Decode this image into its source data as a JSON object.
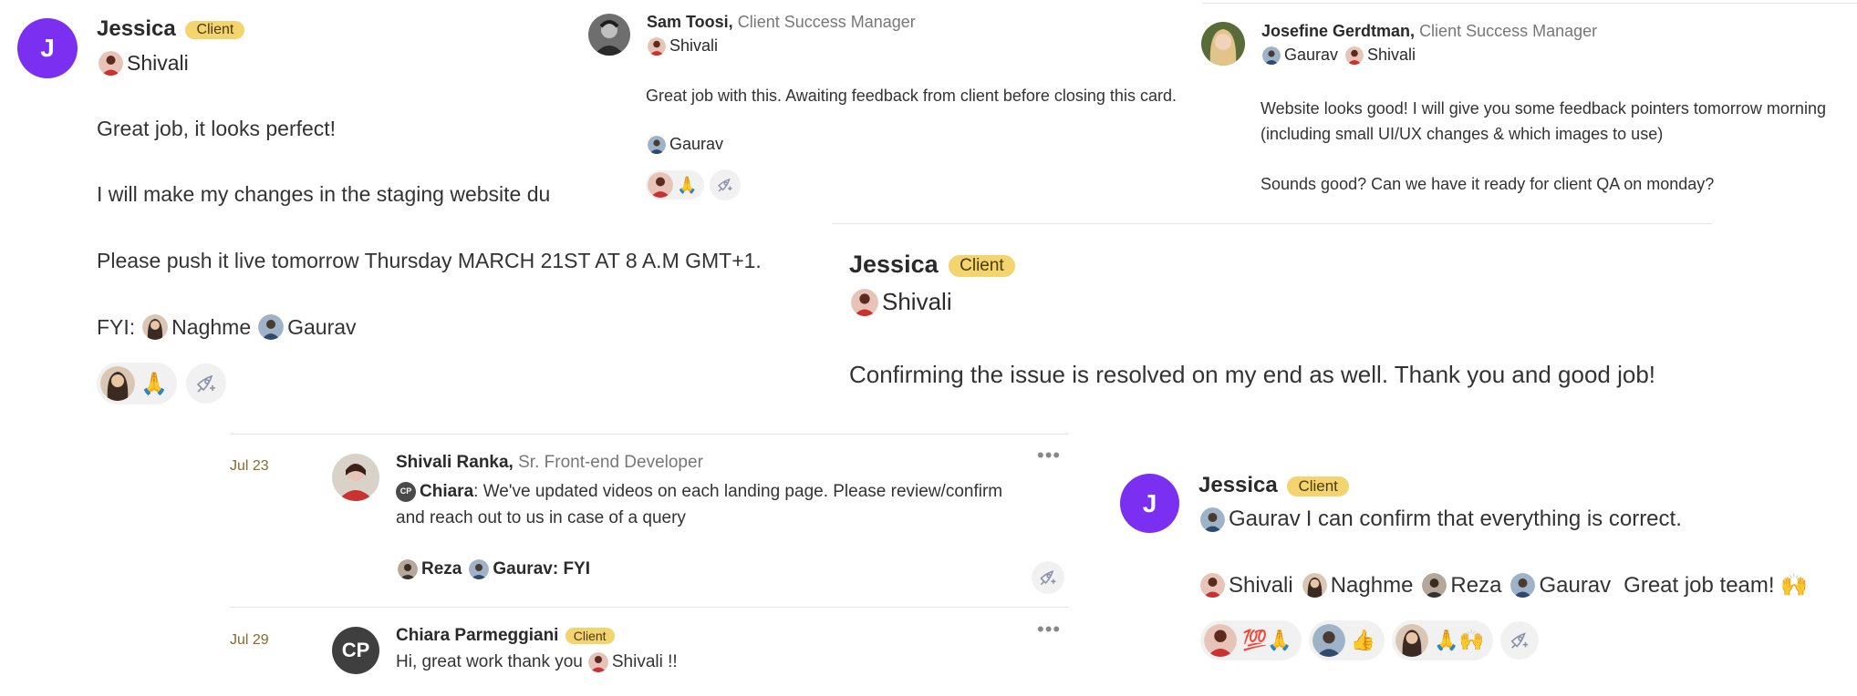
{
  "card1": {
    "avatar_letter": "J",
    "name": "Jessica",
    "badge": "Client",
    "mention": "Shivali",
    "line1": "Great job, it looks perfect!",
    "line2": "I will make my changes in the staging website du",
    "line3": "Please push it live tomorrow Thursday MARCH 21ST AT 8 A.M GMT+1.",
    "fyi_label": "FYI:",
    "fyi_mention1": "Naghme",
    "fyi_mention2": "Gaurav",
    "reaction_emoji": "🙏"
  },
  "card2": {
    "name": "Sam Toosi,",
    "role": "Client Success Manager",
    "mention": "Shivali",
    "text": "Great job with this. Awaiting feedback from client before closing this card.",
    "mention2": "Gaurav",
    "reaction_emoji": "🙏"
  },
  "card3": {
    "name": "Josefine Gerdtman,",
    "role": "Client Success Manager",
    "mention1": "Gaurav",
    "mention2": "Shivali",
    "text1": "Website looks good! I will give you some feedback pointers tomorrow morning",
    "text2": "(including small UI/UX changes & which images to use)",
    "text3": "Sounds good? Can we have it ready for client QA on monday?"
  },
  "card4": {
    "name": "Jessica",
    "badge": "Client",
    "mention": "Shivali",
    "text": "Confirming the issue is resolved on my end as well. Thank you and good job!"
  },
  "card5": {
    "date1": "Jul 23",
    "name1": "Shivali Ranka,",
    "role1": "Sr. Front-end Developer",
    "chiara_initials": "CP",
    "chiara_mention": "Chiara",
    "msg1a": ": We've updated videos on each landing page. Please review/confirm",
    "msg1b": "and reach out to us in case of a query",
    "mention_reza": "Reza",
    "mention_gaurav": "Gaurav: FYI",
    "dots": "•••",
    "date2": "Jul 29",
    "avatar2": "CP",
    "name2": "Chiara Parmeggiani",
    "badge2": "Client",
    "msg2_prefix": "Hi, great work thank you",
    "msg2_mention": "Shivali !!"
  },
  "card6": {
    "avatar_letter": "J",
    "name": "Jessica",
    "badge": "Client",
    "mention": "Gaurav",
    "text1": "I can confirm that everything is correct.",
    "m1": "Shivali",
    "m2": "Naghme",
    "m3": "Reza",
    "m4": "Gaurav",
    "text2": "Great job team! 🙌",
    "r1_emoji": "💯🙏",
    "r2_emoji": "👍",
    "r3_emoji": "🙏🙌"
  },
  "colors": {
    "accent_purple": "#7b2ff0",
    "badge_yellow": "#f3d46e",
    "date_brown": "#8a6a2c"
  },
  "icons": [
    "rocket-add-reaction-icon",
    "more-options-icon"
  ]
}
